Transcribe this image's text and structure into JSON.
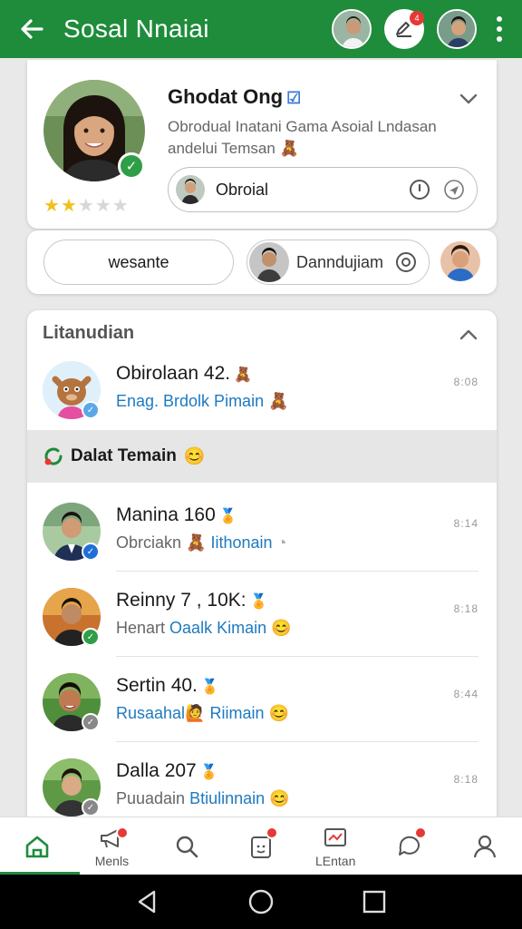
{
  "appbar": {
    "title": "Sosal Nnaiai",
    "notif_badge": "4"
  },
  "profile": {
    "name": "Ghodat Ong",
    "name_badge": "☑",
    "subtitle": "Obrodual Inatani Gama Asoial Lndasan andelui Temsan",
    "subtitle_emoji": "🧸",
    "rating": 2,
    "rating_max": 5,
    "pill_label": "Obroial"
  },
  "actions": {
    "button_label": "wesante",
    "pill_label": "Danndujiam"
  },
  "list": {
    "section_title": "Litanudian",
    "top_item": {
      "name": "Obirolaan 42.",
      "name_emoji": "🧸",
      "sub": "Enag. Brdolk Pimain",
      "sub_emoji": "🧸",
      "time": "8:08"
    },
    "group_title": "Dalat Temain",
    "group_emoji": "😊",
    "items": [
      {
        "name": "Manina 160",
        "name_emoji": "🏅",
        "sub_plain": "Obrciakn",
        "sub_emoji": "🧸",
        "sub_link": "Iithonain",
        "time": "8:14",
        "badge_color": "#1e6fd9"
      },
      {
        "name": "Reinny 7 , 10K:",
        "name_emoji": "🏅",
        "sub_plain": "Henart",
        "sub_emoji": "",
        "sub_link": "Oaalk Kimain",
        "time": "8:18",
        "badge_color": "#2e9e47"
      },
      {
        "name": "Sertin 40.",
        "name_emoji": "🏅",
        "sub_plain": "",
        "sub_emoji": "🙋",
        "sub_link": "Rusaahal",
        "sub_link2": "Riimain",
        "time": "8:44",
        "badge_color": "#888888"
      },
      {
        "name": "Dalla 207",
        "name_emoji": "🏅",
        "sub_plain": "Puuadain",
        "sub_emoji": "",
        "sub_link": "Btiulinnain",
        "time": "8:18",
        "badge_color": "#888888"
      }
    ]
  },
  "bottomnav": {
    "items": [
      {
        "label": "",
        "icon": "home-icon"
      },
      {
        "label": "Menls",
        "icon": "megaphone-icon"
      },
      {
        "label": "",
        "icon": "search-icon"
      },
      {
        "label": "",
        "icon": "clipboard-icon"
      },
      {
        "label": "LEntan",
        "icon": "chart-icon"
      },
      {
        "label": "",
        "icon": "chat-icon"
      },
      {
        "label": "",
        "icon": "person-icon"
      }
    ]
  },
  "colors": {
    "brand_green": "#1e8c3a",
    "link_blue": "#1d7ac0",
    "badge_red": "#e53935"
  }
}
